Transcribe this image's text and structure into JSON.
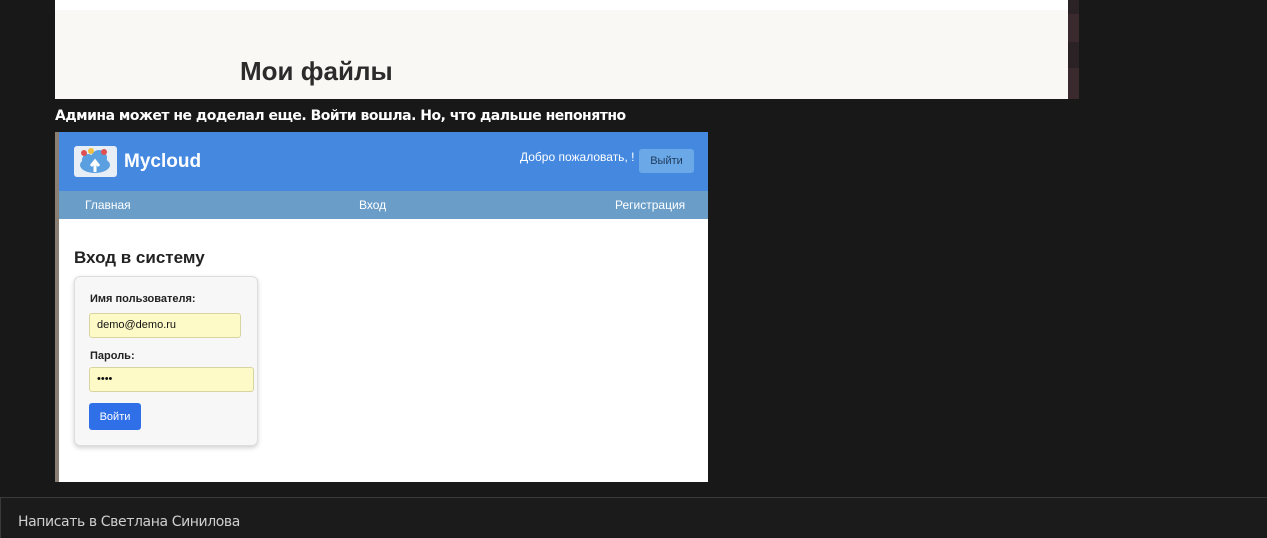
{
  "top_image": {
    "title": "Мои файлы"
  },
  "message": {
    "text": "Админа может не доделал еще. Войти вошла. Но, что дальше непонятно"
  },
  "screenshot": {
    "app_name": "Mycloud",
    "welcome_text": "Добро пожаловать, !",
    "logout_label": "Выйти",
    "nav": {
      "home": "Главная",
      "login": "Вход",
      "register": "Регистрация"
    },
    "login_title": "Вход в систему",
    "username_label": "Имя пользователя:",
    "username_value": "demo@demo.ru",
    "password_label": "Пароль:",
    "password_value": "••••",
    "submit_label": "Войти",
    "colors": {
      "header": "#4488e0",
      "nav": "#6a9ec9",
      "submit": "#2f6fe8",
      "autofill": "#fefac7"
    }
  },
  "reply": {
    "placeholder": "Написать в Светлана Синилова"
  }
}
